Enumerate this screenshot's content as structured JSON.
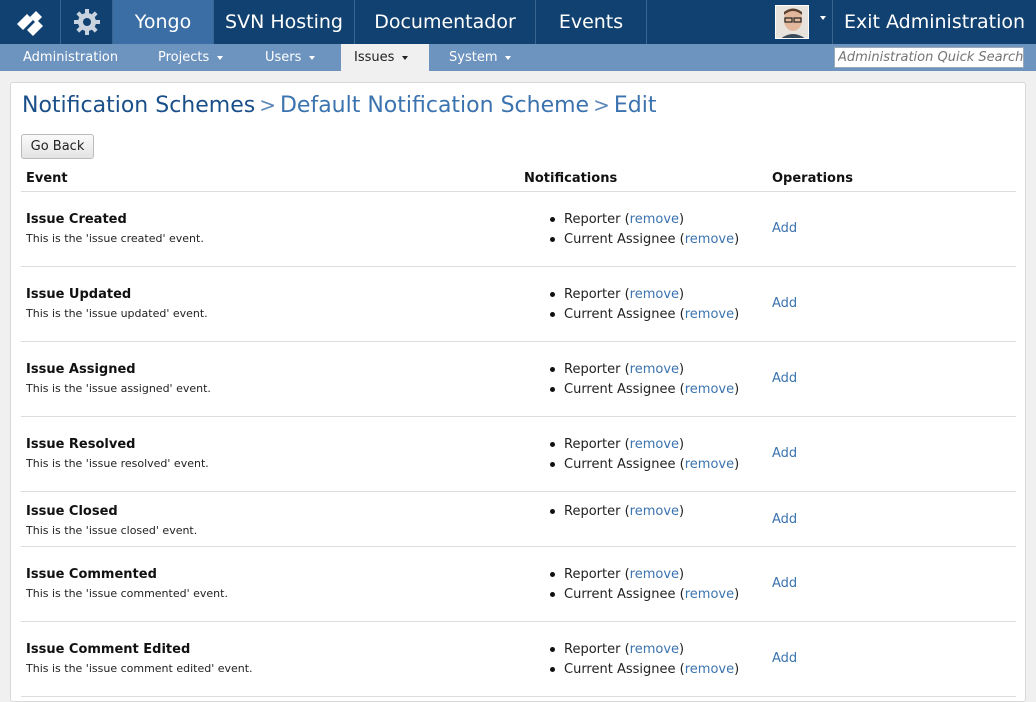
{
  "topbar": {
    "items": [
      "Yongo",
      "SVN Hosting",
      "Documentador",
      "Events"
    ],
    "exit": "Exit Administration"
  },
  "subnav": {
    "items": [
      "Administration",
      "Projects",
      "Users",
      "Issues",
      "System"
    ],
    "search_placeholder": "Administration Quick Search"
  },
  "breadcrumb": {
    "part1": "Notification Schemes",
    "part2": "Default Notification Scheme",
    "part3": "Edit",
    "sep": ">"
  },
  "go_back": "Go Back",
  "table": {
    "headers": {
      "event": "Event",
      "notifications": "Notifications",
      "operations": "Operations"
    },
    "remove_label": "remove",
    "add_label": "Add",
    "rows": [
      {
        "name": "Issue Created",
        "desc": "This is the 'issue created' event.",
        "notifications": [
          "Reporter",
          "Current Assignee"
        ]
      },
      {
        "name": "Issue Updated",
        "desc": "This is the 'issue updated' event.",
        "notifications": [
          "Reporter",
          "Current Assignee"
        ]
      },
      {
        "name": "Issue Assigned",
        "desc": "This is the 'issue assigned' event.",
        "notifications": [
          "Reporter",
          "Current Assignee"
        ]
      },
      {
        "name": "Issue Resolved",
        "desc": "This is the 'issue resolved' event.",
        "notifications": [
          "Reporter",
          "Current Assignee"
        ]
      },
      {
        "name": "Issue Closed",
        "desc": "This is the 'issue closed' event.",
        "notifications": [
          "Reporter"
        ]
      },
      {
        "name": "Issue Commented",
        "desc": "This is the 'issue commented' event.",
        "notifications": [
          "Reporter",
          "Current Assignee"
        ]
      },
      {
        "name": "Issue Comment Edited",
        "desc": "This is the 'issue comment edited' event.",
        "notifications": [
          "Reporter",
          "Current Assignee"
        ]
      }
    ]
  }
}
